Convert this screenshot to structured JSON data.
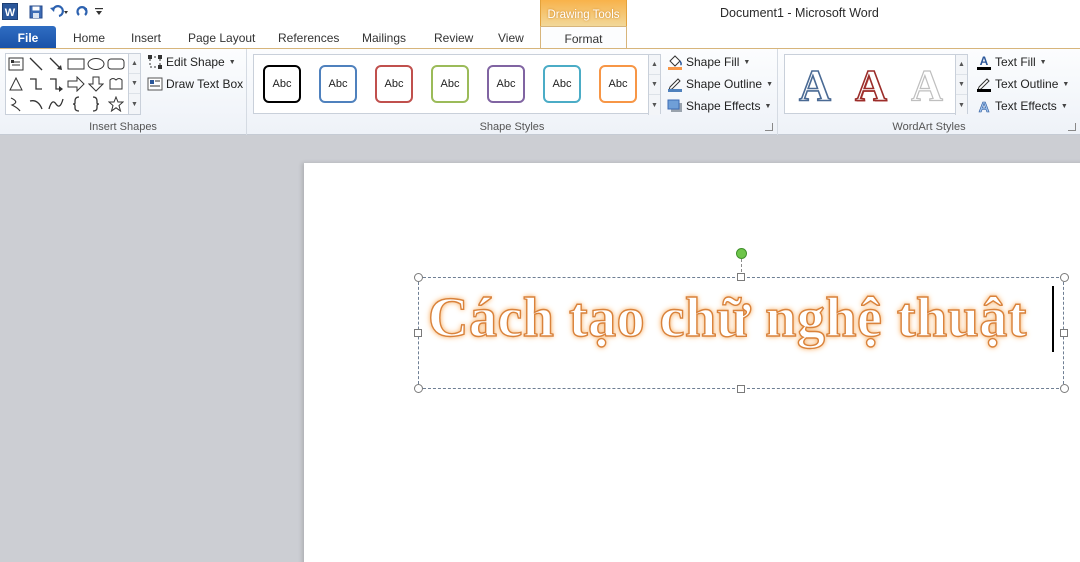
{
  "window": {
    "title": "Document1  -  Microsoft Word",
    "context_tab_group": "Drawing Tools"
  },
  "tabs": [
    {
      "label": "File"
    },
    {
      "label": "Home"
    },
    {
      "label": "Insert"
    },
    {
      "label": "Page Layout"
    },
    {
      "label": "References"
    },
    {
      "label": "Mailings"
    },
    {
      "label": "Review"
    },
    {
      "label": "View"
    },
    {
      "label": "Format"
    }
  ],
  "ribbon": {
    "insert_shapes": {
      "label": "Insert Shapes",
      "edit_shape": "Edit Shape",
      "draw_text_box": "Draw Text Box"
    },
    "shape_styles": {
      "label": "Shape Styles",
      "preview_text": "Abc",
      "style_colors": [
        "#000000",
        "#4f81bd",
        "#c0504d",
        "#9bbb59",
        "#8064a2",
        "#4bacc6",
        "#f79646"
      ],
      "shape_fill": "Shape Fill",
      "shape_outline": "Shape Outline",
      "shape_effects": "Shape Effects"
    },
    "wordart_styles": {
      "label": "WordArt Styles",
      "preview_letter": "A",
      "text_fill": "Text Fill",
      "text_outline": "Text Outline",
      "text_effects": "Text Effects"
    }
  },
  "document": {
    "wordart_text": "Cách tạo chữ nghệ thuật"
  },
  "colors": {
    "accent_orange": "#f79646",
    "file_tab_blue": "#2a62b8",
    "wordart_glow": "#f7b36a"
  }
}
